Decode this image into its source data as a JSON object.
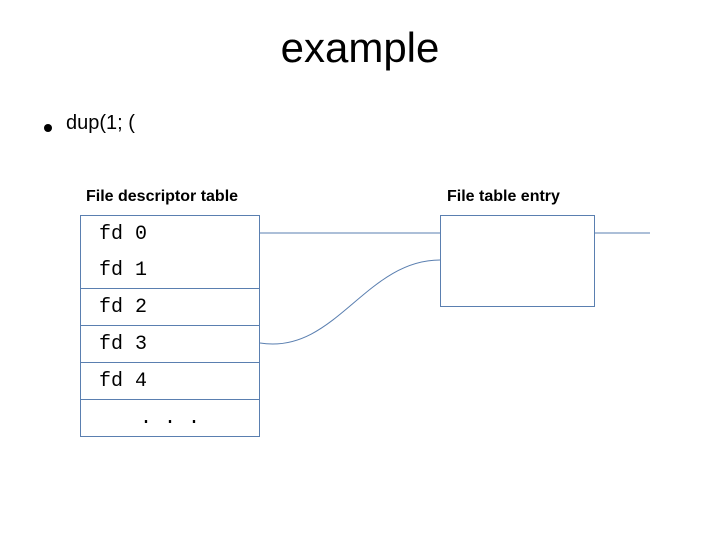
{
  "title": "example",
  "bullet": {
    "text": "dup(1; ("
  },
  "labels": {
    "fd_table": "File descriptor table",
    "ft_entry": "File table entry"
  },
  "fd_rows": {
    "r0": "fd 0",
    "r1": "fd 1",
    "r2": "fd 2",
    "r3": "fd 3",
    "r4": "fd 4",
    "r5": ". . ."
  },
  "colors": {
    "line": "#5a7fb0"
  }
}
